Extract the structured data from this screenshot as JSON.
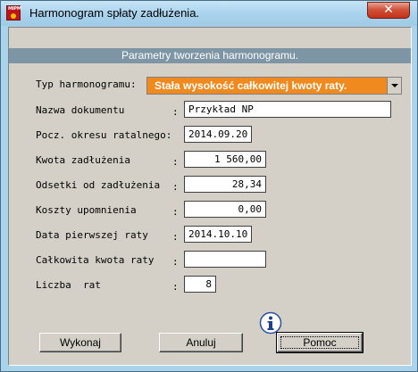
{
  "window": {
    "title": "Harmonogram spłaty zadłużenia.",
    "icon_text": "MIPM",
    "close_symbol": "✕"
  },
  "panel": {
    "heading": "Parametry tworzenia harmonogramu."
  },
  "form": {
    "colon": ":",
    "typ_label": "Typ harmonogramu:",
    "typ_value": "Stała wysokość całkowitej kwoty raty.",
    "nazwa_label": "Nazwa dokumentu",
    "nazwa_value": "Przykład NP",
    "pocz_label": "Pocz. okresu ratalnego:",
    "pocz_value": "2014.09.20",
    "kwota_label": "Kwota zadłużenia",
    "kwota_value": "1 560,00",
    "odsetki_label": "Odsetki od zadłużenia",
    "odsetki_value": "28,34",
    "koszty_label": "Koszty upomnienia",
    "koszty_value": "0,00",
    "data_label": "Data pierwszej raty",
    "data_value": "2014.10.10",
    "calk_label": "Całkowita kwota raty",
    "calk_value": "",
    "liczba_label": "Liczba  rat",
    "liczba_value": "8"
  },
  "buttons": {
    "wykonaj": "Wykonaj",
    "anuluj": "Anuluj",
    "pomoc": "Pomoc"
  },
  "colors": {
    "combo_bg": "#f08a1e",
    "panel_bar": "#7d95a5",
    "close_button": "#c43018"
  }
}
